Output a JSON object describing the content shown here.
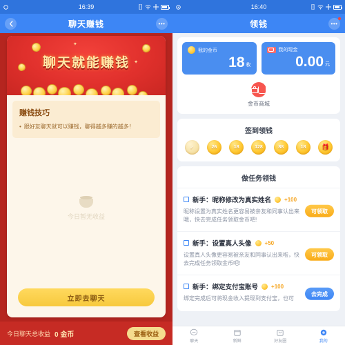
{
  "left": {
    "status": {
      "time": "16:39"
    },
    "nav": {
      "back_icon": "chevron-left-icon",
      "title": "聊天赚钱",
      "more_icon": "ellipsis-icon",
      "more_label": "•••"
    },
    "banner": {
      "title": "聊天就能赚钱"
    },
    "tips": {
      "title": "赚钱技巧",
      "items": [
        "跟好友聊天就可以赚钱，聊得越多赚的越多！"
      ]
    },
    "empty": {
      "text": "今日暂无收益",
      "icon": "empty-bowl-icon"
    },
    "cta": {
      "label": "立即去聊天"
    },
    "bottom": {
      "label": "今日聊天总收益",
      "value": "0 金币",
      "button": "查看收益"
    }
  },
  "right": {
    "status": {
      "time": "16:40"
    },
    "nav": {
      "title": "领钱",
      "more_label": "•••",
      "more_icon": "ellipsis-icon"
    },
    "wallet": [
      {
        "label": "我的金币",
        "value": "18",
        "unit": "枚",
        "icon": "coin-icon"
      },
      {
        "label": "我的现金",
        "value": "0.00",
        "unit": "元",
        "icon": "cash-icon"
      }
    ],
    "shop": {
      "label": "金币商城",
      "icon": "shopping-bag-icon"
    },
    "signin": {
      "title": "签到领钱",
      "days": [
        {
          "value": "✓",
          "state": "done"
        },
        {
          "value": "26",
          "state": "pending"
        },
        {
          "value": "18",
          "state": "pending"
        },
        {
          "value": "128",
          "state": "pending"
        },
        {
          "value": "88",
          "state": "pending"
        },
        {
          "value": "18",
          "state": "pending"
        },
        {
          "value": "🎁",
          "state": "gift"
        }
      ]
    },
    "tasks": {
      "title": "做任务领钱",
      "items": [
        {
          "title": "新手：昵称修改为真实姓名",
          "reward": "+100",
          "desc": "昵称设置为真实姓名更容易被亲友和同事认出来哦，快去完成任务领取金币吧!",
          "button": "可领取",
          "button_style": "claim"
        },
        {
          "title": "新手：设置真人头像",
          "reward": "+50",
          "desc": "设置真人头像更容易被亲友和同事认出来啦，快去完成任务领取金币吧!",
          "button": "可领取",
          "button_style": "claim"
        },
        {
          "title": "新手：绑定支付宝账号",
          "reward": "+100",
          "desc": "绑定完成后可将现金收入提现到支付宝，也可",
          "button": "去完成",
          "button_style": "go"
        }
      ]
    },
    "tabbar": [
      {
        "label": "聊天",
        "icon": "chat-bubble-icon",
        "active": false
      },
      {
        "label": "新鲜",
        "icon": "feed-icon",
        "active": false
      },
      {
        "label": "好友圈",
        "icon": "friends-icon",
        "active": false
      },
      {
        "label": "我的",
        "icon": "profile-icon",
        "active": true
      }
    ]
  }
}
